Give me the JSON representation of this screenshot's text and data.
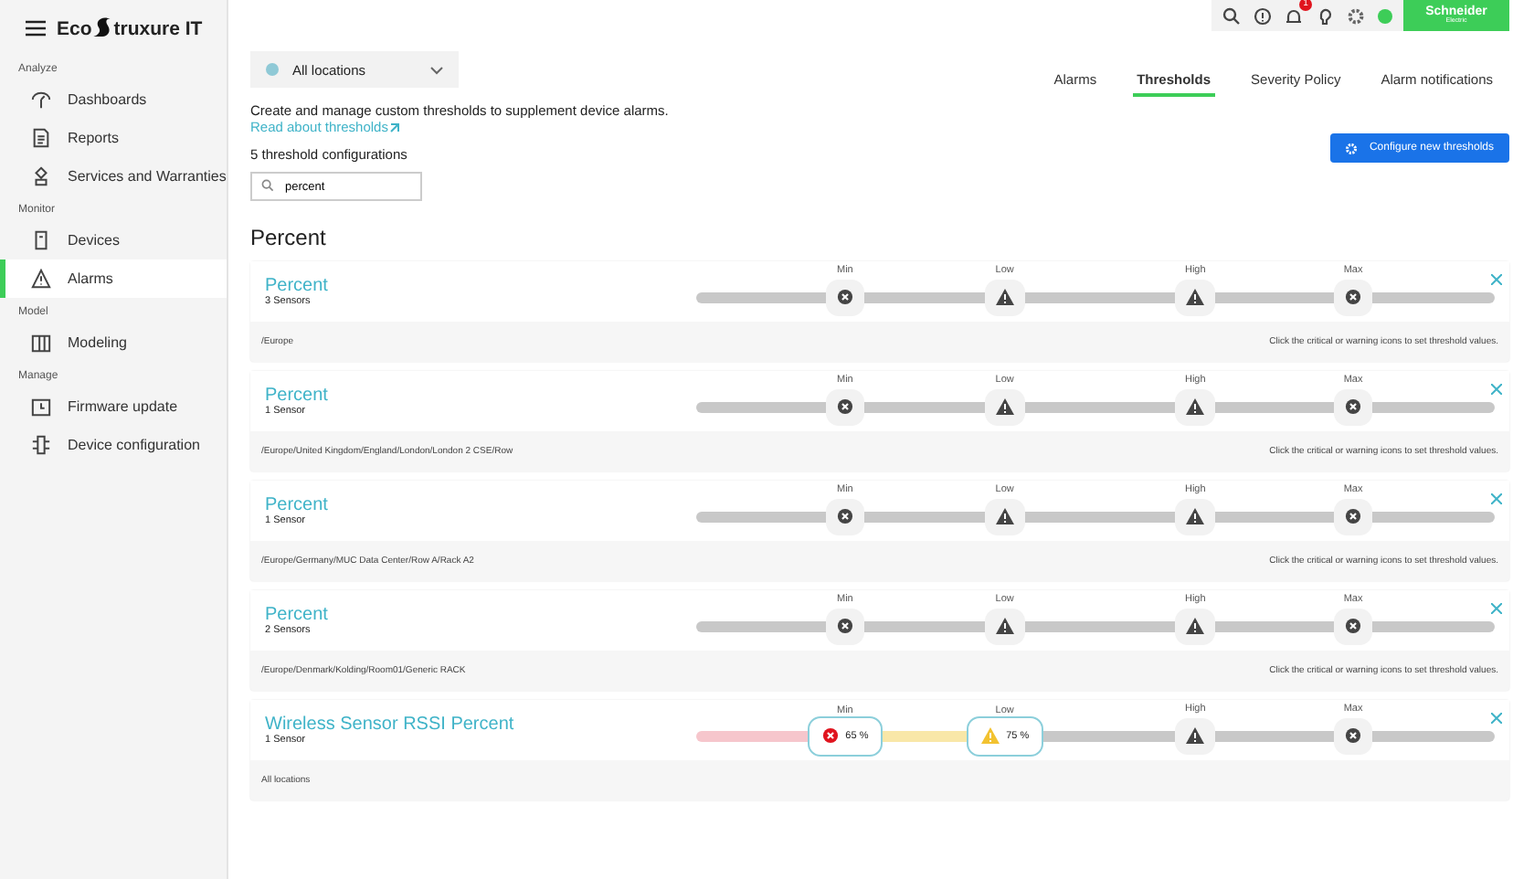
{
  "app": {
    "brand_start": "Eco",
    "brand_end": "truxure IT"
  },
  "sidebar": {
    "sections": [
      {
        "title": "Analyze",
        "items": [
          {
            "label": "Dashboards",
            "selected": false
          },
          {
            "label": "Reports",
            "selected": false
          },
          {
            "label": "Services and Warranties",
            "selected": false
          }
        ]
      },
      {
        "title": "Monitor",
        "items": [
          {
            "label": "Devices",
            "selected": false
          },
          {
            "label": "Alarms",
            "selected": true
          }
        ]
      },
      {
        "title": "Model",
        "items": [
          {
            "label": "Modeling",
            "selected": false
          }
        ]
      },
      {
        "title": "Manage",
        "items": [
          {
            "label": "Firmware update",
            "selected": false
          },
          {
            "label": "Device configuration",
            "selected": false
          }
        ]
      }
    ]
  },
  "topbar": {
    "notification_count": "1",
    "vendor": "Schneider",
    "vendor_sub": "Electric"
  },
  "location_select": {
    "value": "All locations"
  },
  "tabs": [
    {
      "label": "Alarms",
      "selected": false
    },
    {
      "label": "Thresholds",
      "selected": true
    },
    {
      "label": "Severity Policy",
      "selected": false
    },
    {
      "label": "Alarm notifications",
      "selected": false
    }
  ],
  "intro": "Create and manage custom thresholds to supplement device alarms.",
  "read_more_link": "Read about thresholds",
  "count_text": "5 threshold configurations",
  "search": {
    "value": "percent"
  },
  "configure_button": "Configure new thresholds",
  "group_title": "Percent",
  "configurations": [
    {
      "name": "Percent",
      "sensors": "3 Sensors",
      "path": "/Europe",
      "hint": "Click the critical or warning icons to set threshold values.",
      "thresholds": [
        {
          "label": "Min",
          "kind": "critical"
        },
        {
          "label": "Low",
          "kind": "warning"
        },
        {
          "label": "High",
          "kind": "warning"
        },
        {
          "label": "Max",
          "kind": "critical"
        }
      ]
    },
    {
      "name": "Percent",
      "sensors": "1 Sensor",
      "path": "/Europe/United Kingdom/England/London/London 2 CSE/Row",
      "hint": "Click the critical or warning icons to set threshold values.",
      "thresholds": [
        {
          "label": "Min",
          "kind": "critical"
        },
        {
          "label": "Low",
          "kind": "warning"
        },
        {
          "label": "High",
          "kind": "warning"
        },
        {
          "label": "Max",
          "kind": "critical"
        }
      ]
    },
    {
      "name": "Percent",
      "sensors": "1 Sensor",
      "path": "/Europe/Germany/MUC Data Center/Row A/Rack A2",
      "hint": "Click the critical or warning icons to set threshold values.",
      "thresholds": [
        {
          "label": "Min",
          "kind": "critical"
        },
        {
          "label": "Low",
          "kind": "warning"
        },
        {
          "label": "High",
          "kind": "warning"
        },
        {
          "label": "Max",
          "kind": "critical"
        }
      ]
    },
    {
      "name": "Percent",
      "sensors": "2 Sensors",
      "path": "/Europe/Denmark/Kolding/Room01/Generic RACK",
      "hint": "Click the critical or warning icons to set threshold values.",
      "thresholds": [
        {
          "label": "Min",
          "kind": "critical"
        },
        {
          "label": "Low",
          "kind": "warning"
        },
        {
          "label": "High",
          "kind": "warning"
        },
        {
          "label": "Max",
          "kind": "critical"
        }
      ]
    },
    {
      "name": "Wireless Sensor RSSI Percent",
      "sensors": "1 Sensor",
      "path": "All locations",
      "thresholds": [
        {
          "label": "Min",
          "kind": "critical",
          "value": "65 %"
        },
        {
          "label": "Low",
          "kind": "warning",
          "value": "75 %"
        },
        {
          "label": "High",
          "kind": "warning"
        },
        {
          "label": "Max",
          "kind": "critical"
        }
      ]
    }
  ]
}
